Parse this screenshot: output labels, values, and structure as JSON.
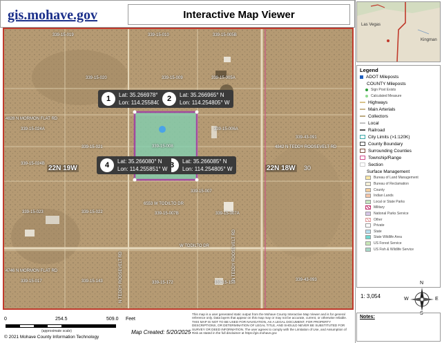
{
  "header": {
    "site_link": "gis.mohave.gov",
    "title": "Interactive Map Viewer"
  },
  "map": {
    "parcels": [
      "339-15-019",
      "339-15-010",
      "339-15-005B",
      "339-15-020",
      "339-15-009",
      "339-15-005A",
      "339-15-021",
      "339-15-006A",
      "339-15-024A",
      "339-15-008",
      "339-43-091",
      "339-15-024B",
      "339-15-022",
      "339-15-007B",
      "339-15-007A",
      "339-15-023",
      "339-15-017",
      "339-15-143",
      "339-15-172",
      "339-15-158",
      "339-43-093",
      "339-15-007"
    ],
    "roads": [
      "4828 N MORMON FLAT RD",
      "4842 N TEDDY ROOSEVELT RD",
      "6553 W TODILTO DR",
      "W TODILTO DR",
      "4746 N MORMON FLAT RD",
      "N TEDDY ROOSEVELT RD",
      "N TEDDY ROOSEVELT RD"
    ],
    "townships": [
      "22N 19W",
      "22N 18W"
    ],
    "sections": [
      "30"
    ],
    "callouts": [
      {
        "num": "1",
        "lat": "Lat: 35.266978° N",
        "lon": "Lon: 114.255840° W"
      },
      {
        "num": "2",
        "lat": "Lat: 35.266965° N",
        "lon": "Lon: 114.254805° W"
      },
      {
        "num": "3",
        "lat": "Lat: 35.266085° N",
        "lon": "Lon: 114.254805° W"
      },
      {
        "num": "4",
        "lat": "Lat: 35.266080° N",
        "lon": "Lon: 114.255851° W"
      }
    ]
  },
  "footer": {
    "scale": [
      "0",
      "254.5",
      "509.0",
      "Feet"
    ],
    "approx": "(approximate scale)",
    "copyright": "© 2021 Mohave County Information Technology",
    "created": "Map Created: 5/20/2025",
    "disclaimer": "This map is a user generated static output from the Mohave County Interactive Map Viewer and is for general reference only. Data layers that appear on this map may or may not be accurate, current, or otherwise reliable. THIS MAP IS NOT TO BE USED FOR NAVIGATION, AS A LEGAL DOCUMENT, FOR PROPERTY DESCRIPTIONS, OR DETERMINATION OF LEGAL TITLE, AND SHOULD NEVER BE SUBSTITUTED FOR SURVEY OR DEED INFORMATION. The user agrees to comply with the Limitation of Use, and Assumption of Risk as stated in the full disclaimer at https://gis.mohave.gov"
  },
  "overview": {
    "labels": [
      "Las Vegas",
      "Kingman"
    ]
  },
  "legend": {
    "title": "Legend",
    "items": [
      {
        "label": "ADOT Mileposts",
        "kind": "main",
        "color": "#1f5fbf",
        "shape": "square"
      },
      {
        "label": "COUNTY Mileposts",
        "kind": "indent",
        "color": "",
        "shape": "none"
      },
      {
        "label": "Sign Post Exists",
        "kind": "sub",
        "color": "#2e9e3a",
        "shape": "dot"
      },
      {
        "label": "Calculated Measure",
        "kind": "sub",
        "color": "#8fd98f",
        "shape": "dot"
      },
      {
        "label": "Highways",
        "kind": "main",
        "color": "#d9c38a",
        "shape": "line"
      },
      {
        "label": "Main Arterials",
        "kind": "main",
        "color": "#c8b48a",
        "shape": "line"
      },
      {
        "label": "Collectors",
        "kind": "main",
        "color": "#bba97f",
        "shape": "line"
      },
      {
        "label": "Local",
        "kind": "main",
        "color": "#bfbfbf",
        "shape": "line"
      },
      {
        "label": "Railroad",
        "kind": "main",
        "color": "#555555",
        "shape": "rail"
      },
      {
        "label": "City Limits (>1:120K)",
        "kind": "main",
        "color": "#3aa6a6",
        "shape": "box"
      },
      {
        "label": "County Boundary",
        "kind": "main",
        "color": "#444444",
        "shape": "box"
      },
      {
        "label": "Surrounding Counties",
        "kind": "main",
        "color": "#7a4a3a",
        "shape": "box"
      },
      {
        "label": "Township/Range",
        "kind": "main",
        "color": "#d04a8a",
        "shape": "box"
      },
      {
        "label": "Section",
        "kind": "main",
        "color": "#cccccc",
        "shape": "box"
      },
      {
        "label": "Surface Management",
        "kind": "indent",
        "color": "",
        "shape": "none"
      },
      {
        "label": "Bureau of Land Management",
        "kind": "sub",
        "color": "#fde9a8",
        "shape": "fill"
      },
      {
        "label": "Bureau of Reclamation",
        "kind": "sub",
        "color": "#f5f0d8",
        "shape": "fill"
      },
      {
        "label": "County",
        "kind": "sub",
        "color": "#f4cfa0",
        "shape": "fill"
      },
      {
        "label": "Indian Lands",
        "kind": "sub",
        "color": "#f6c6a8",
        "shape": "fill"
      },
      {
        "label": "Local or State Parks",
        "kind": "sub",
        "color": "#c6e6c0",
        "shape": "fill"
      },
      {
        "label": "Military",
        "kind": "sub",
        "color": "#c0306a",
        "shape": "hatch"
      },
      {
        "label": "National Parks Service",
        "kind": "sub",
        "color": "#d7c7e8",
        "shape": "fill"
      },
      {
        "label": "Other",
        "kind": "sub",
        "color": "#e0a0a0",
        "shape": "hatch"
      },
      {
        "label": "Private",
        "kind": "sub",
        "color": "#ffffff",
        "shape": "fill"
      },
      {
        "label": "State",
        "kind": "sub",
        "color": "#b8e0f0",
        "shape": "fill"
      },
      {
        "label": "State Wildlife Area",
        "kind": "sub",
        "color": "#6fd9d0",
        "shape": "fill"
      },
      {
        "label": "US Forest Service",
        "kind": "sub",
        "color": "#c8e8b8",
        "shape": "fill"
      },
      {
        "label": "US Fish & Wildlife Service",
        "kind": "sub",
        "color": "#a8d8c8",
        "shape": "fill"
      }
    ]
  },
  "ratio": "1: 3,054",
  "compass_letters": [
    "N",
    "S",
    "E",
    "W"
  ],
  "notes_label": "Notes:",
  "colors": {
    "accent_red": "#c0392b",
    "parcel_highlight": "#9b2fae",
    "site_link": "#1a2f8a",
    "callout_bg": "#3a3a3a"
  }
}
